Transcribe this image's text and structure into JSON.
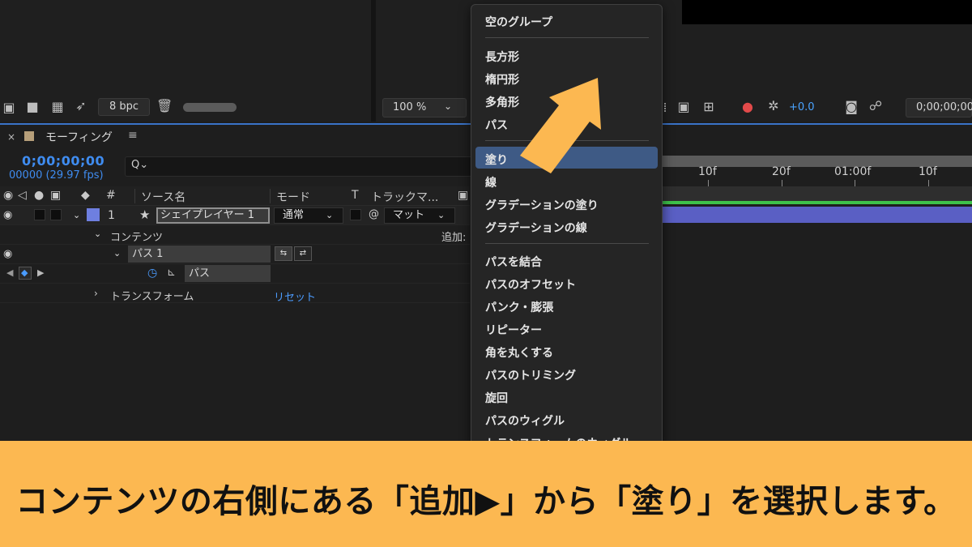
{
  "top_toolbar": {
    "bpc_label": "8 bpc",
    "zoom_value": "100 %",
    "exposure_value": "+0.0",
    "timecode": "0;00;00;00"
  },
  "timeline": {
    "tab_close": "×",
    "tab_title": "モーフィング",
    "tab_menu": "≡",
    "current_time": "0;00;00;00",
    "frame_info": "00000 (29.97 fps)",
    "search_glyph": "Q⌄",
    "columns": {
      "number": "#",
      "source_name": "ソース名",
      "mode": "モード",
      "t": "T",
      "track_matte": "トラックマ..."
    },
    "layer": {
      "number": "1",
      "name": "シェイプレイヤー 1",
      "mode": "通常",
      "matte": "マット"
    },
    "contents_label": "コンテンツ",
    "add_label": "追加:",
    "path_group": "パス 1",
    "path_property": "パス",
    "transform_label": "トランスフォーム",
    "reset_label": "リセット",
    "ruler_ticks": [
      "10f",
      "20f",
      "01:00f",
      "10f"
    ]
  },
  "menu": {
    "group1": [
      "空のグループ"
    ],
    "group2": [
      "長方形",
      "楕円形",
      "多角形",
      "パス"
    ],
    "group3": [
      "塗り",
      "線",
      "グラデーションの塗り",
      "グラデーションの線"
    ],
    "group4": [
      "パスを結合",
      "パスのオフセット",
      "パンク・膨張",
      "リピーター",
      "角を丸くする",
      "パスのトリミング",
      "旋回",
      "パスのウィグル",
      "トランスフォームのウィグル"
    ],
    "selected": "塗り"
  },
  "caption": {
    "text": "コンテンツの右側にある「追加▶」から「塗り」を選択します。"
  },
  "colors": {
    "accent_blue": "#3f8cf0",
    "arrow": "#fcb851",
    "caption_band": "#fcb851",
    "menu_highlight": "#3e5a85",
    "layer_bar": "#5a5fc4",
    "green_line": "#3ec24a"
  }
}
